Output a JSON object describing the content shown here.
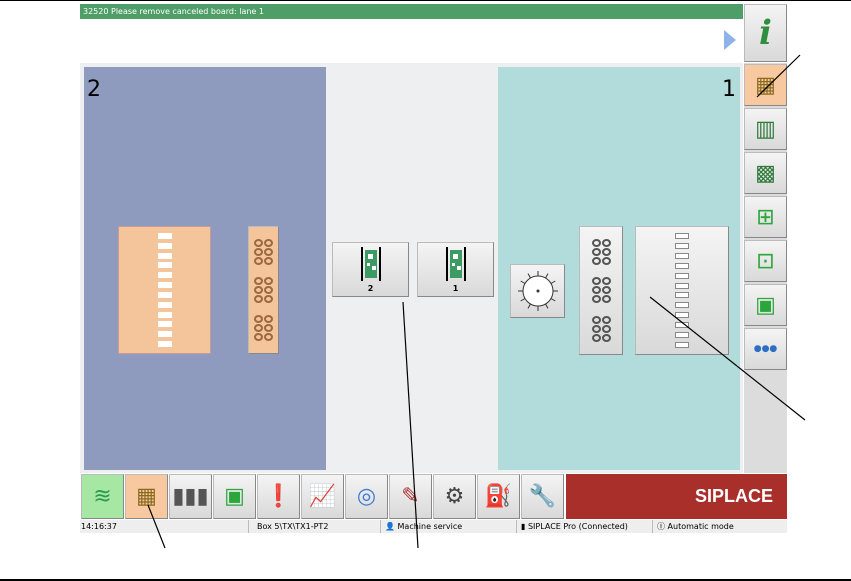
{
  "message": "32520 Please remove canceled board: lane 1",
  "lanes": {
    "left_number": "2",
    "right_number": "1"
  },
  "conveyor": [
    {
      "label": "2"
    },
    {
      "label": "1"
    }
  ],
  "side_buttons": [
    "info-icon",
    "feeder-grid-icon",
    "table-grid-icon",
    "table-grid-2-icon",
    "component-camera-icon",
    "component-icon",
    "board-icon",
    "nozzle-icon"
  ],
  "bottom_buttons": [
    "production-stack-icon",
    "feeder-grid-icon",
    "bar-chart-icon",
    "board-icon",
    "warning-cards-icon",
    "line-chart-icon",
    "camera-icon",
    "tool-icon",
    "hand-gear-icon",
    "oil-can-icon",
    "wrench-icon"
  ],
  "brand": "SIPLACE",
  "status": {
    "time": "14:16:37",
    "path": "Box 5\\TX\\TX1-PT2",
    "user": "Machine service",
    "connection": "SIPLACE Pro (Connected)",
    "mode": "Automatic mode"
  },
  "colors": {
    "message_bg": "#4f9e68",
    "lane2": "#8f9abf",
    "lane1": "#b2dcdc",
    "active": "#f8c9a0",
    "brand": "#a92f2b"
  }
}
